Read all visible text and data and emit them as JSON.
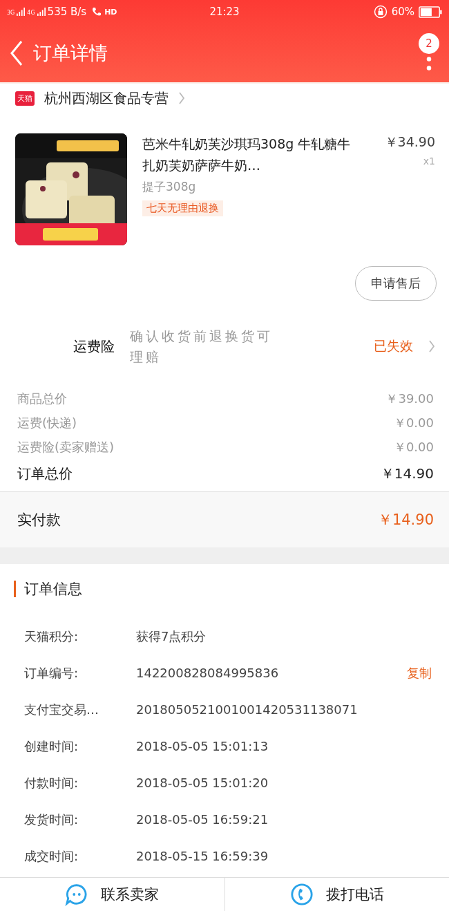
{
  "status_bar": {
    "network_1": "3G",
    "network_2": "4G",
    "speed": "535 B/s",
    "hd": "HD",
    "time": "21:23",
    "battery": "60%"
  },
  "header": {
    "title": "订单详情",
    "badge": "2"
  },
  "shop": {
    "badge": "天猫",
    "name": "杭州西湖区食品专营"
  },
  "product": {
    "kind": "picture",
    "title": "芭米牛轧奶芙沙琪玛308g 牛轧糖牛扎奶芙奶萨萨牛奶…",
    "variant": "提子308g",
    "tag": "七天无理由退换",
    "price": "￥34.90",
    "quantity": "x1",
    "after_sales_button": "申请售后"
  },
  "insurance": {
    "label": "运费险",
    "description": "确认收货前退换货可理赔",
    "status": "已失效"
  },
  "price_rows": [
    {
      "label": "商品总价",
      "value": "￥39.00",
      "kind": "minor"
    },
    {
      "label": "运费(快递)",
      "value": "￥0.00",
      "kind": "minor"
    },
    {
      "label": "运费险(卖家赠送)",
      "value": "￥0.00",
      "kind": "minor"
    },
    {
      "label": "订单总价",
      "value": "￥14.90",
      "kind": "total"
    }
  ],
  "payment": {
    "label": "实付款",
    "value": "￥14.90"
  },
  "order_info": {
    "title": "订单信息",
    "rows": [
      {
        "label": "天猫积分:",
        "value": "获得7点积分"
      },
      {
        "label": "订单编号:",
        "value": "142200828084995836",
        "action": "复制"
      },
      {
        "label": "支付宝交易…",
        "value": "2018050521001001420531138071"
      },
      {
        "label": "创建时间:",
        "value": "2018-05-05 15:01:13"
      },
      {
        "label": "付款时间:",
        "value": "2018-05-05 15:01:20"
      },
      {
        "label": "发货时间:",
        "value": "2018-05-05 16:59:21"
      },
      {
        "label": "成交时间:",
        "value": "2018-05-15 16:59:39"
      }
    ]
  },
  "bottom_bar": [
    {
      "label": "联系卖家",
      "kind": "chat"
    },
    {
      "label": "拨打电话",
      "kind": "call"
    }
  ]
}
